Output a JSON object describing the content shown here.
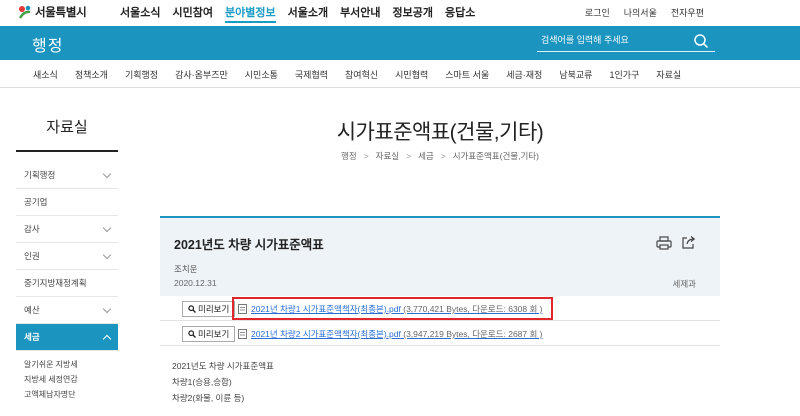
{
  "top": {
    "logo_text": "서울특별시",
    "gnb": [
      "서울소식",
      "시민참여",
      "분야별정보",
      "서울소개",
      "부서안내",
      "정보공개",
      "응답소"
    ],
    "gnb_active_index": 2,
    "util": [
      "로그인",
      "나의서울",
      "전자우편"
    ]
  },
  "header": {
    "title": "행정",
    "search_placeholder": "검색어를 입력해 주세요"
  },
  "subnav": [
    "새소식",
    "정책소개",
    "기획행정",
    "감사·옴부즈만",
    "시민소통",
    "국제협력",
    "참여혁신",
    "시민협력",
    "스마트 서울",
    "세금·재정",
    "남북교류",
    "1인가구",
    "자료실"
  ],
  "sidebar": {
    "title": "자료실",
    "items": [
      {
        "label": "기획행정",
        "chevron": true
      },
      {
        "label": "공기업",
        "chevron": false
      },
      {
        "label": "감사",
        "chevron": true
      },
      {
        "label": "인권",
        "chevron": true
      },
      {
        "label": "중기지방재정계획",
        "chevron": false
      },
      {
        "label": "예산",
        "chevron": true
      },
      {
        "label": "세금",
        "chevron": true,
        "active": true
      }
    ],
    "subitems": [
      "알기쉬운 지방세",
      "지방세 세정연감",
      "고액체납자명단"
    ]
  },
  "page": {
    "title": "시가표준액표(건물,기타)",
    "breadcrumb": [
      "행정",
      "자료실",
      "세금",
      "시가표준액표(건물,기타)"
    ]
  },
  "post": {
    "title": "2021년도 차량 시가표준액표",
    "author": "조치운",
    "date": "2020.12.31",
    "dept": "세제과",
    "files": [
      {
        "preview": "미리보기",
        "name": "2021년 차량1 시가표준액책자(최종본).pdf",
        "meta": " (3,770,421 Bytes, 다운로드: 6308 회 )"
      },
      {
        "preview": "미리보기",
        "name": "2021년 차량2 시가표준액책자(최종본).pdf",
        "meta": " (3,947,219 Bytes, 다운로드: 2687 회 )"
      }
    ],
    "body": [
      "2021년도 차량 시가표준액표",
      "차량1(승용,승합)",
      "차량2(화물, 이륜 등)"
    ]
  },
  "colors": {
    "brand": "#1b95bf",
    "highlight": "#e0252b",
    "link": "#2a6fd6"
  }
}
